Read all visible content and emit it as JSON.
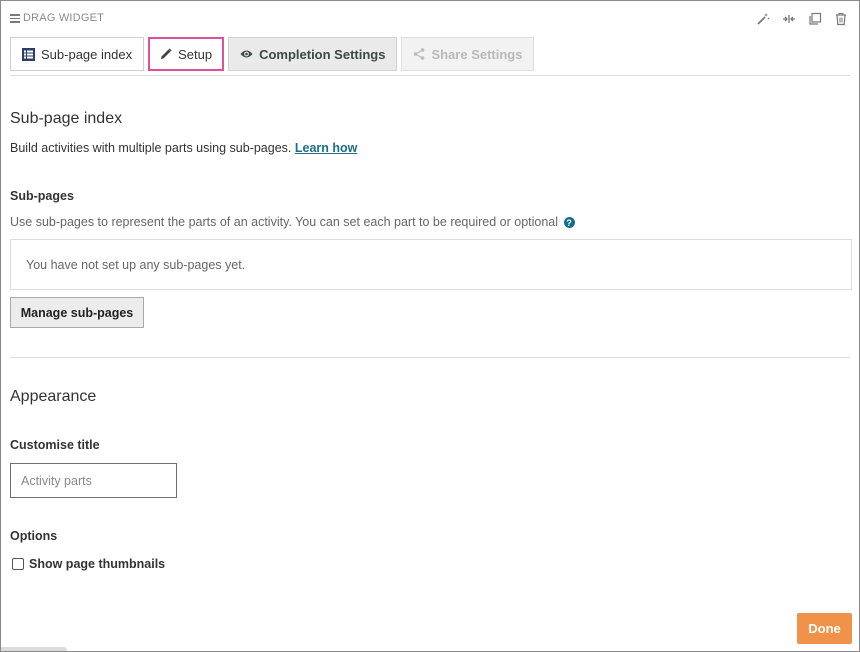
{
  "widget": {
    "header_label": "DRAG WIDGET"
  },
  "toolbar_icons": [
    "magic-wand-icon",
    "collapse-icon",
    "duplicate-icon",
    "trash-icon"
  ],
  "tabs": [
    {
      "label": "Sub-page index",
      "icon": "list-icon",
      "state": "normal"
    },
    {
      "label": "Setup",
      "icon": "pencil-icon",
      "state": "active"
    },
    {
      "label": "Completion Settings",
      "icon": "eye-icon",
      "state": "normal"
    },
    {
      "label": "Share Settings",
      "icon": "share-icon",
      "state": "disabled"
    }
  ],
  "subpage_index": {
    "heading": "Sub-page index",
    "description": "Build activities with multiple parts using sub-pages.",
    "learn_link": "Learn how"
  },
  "subpages": {
    "label": "Sub-pages",
    "hint": "Use sub-pages to represent the parts of an activity. You can set each part to be required or optional",
    "empty_text": "You have not set up any sub-pages yet.",
    "manage_button": "Manage sub-pages"
  },
  "appearance": {
    "heading": "Appearance",
    "customise_label": "Customise title",
    "title_placeholder": "Activity parts",
    "options_label": "Options",
    "thumbnails_label": "Show page thumbnails",
    "thumbnails_checked": false
  },
  "footer": {
    "done_label": "Done"
  },
  "colors": {
    "accent": "#e0509a",
    "done": "#f0924a",
    "link": "#1f6d88"
  }
}
